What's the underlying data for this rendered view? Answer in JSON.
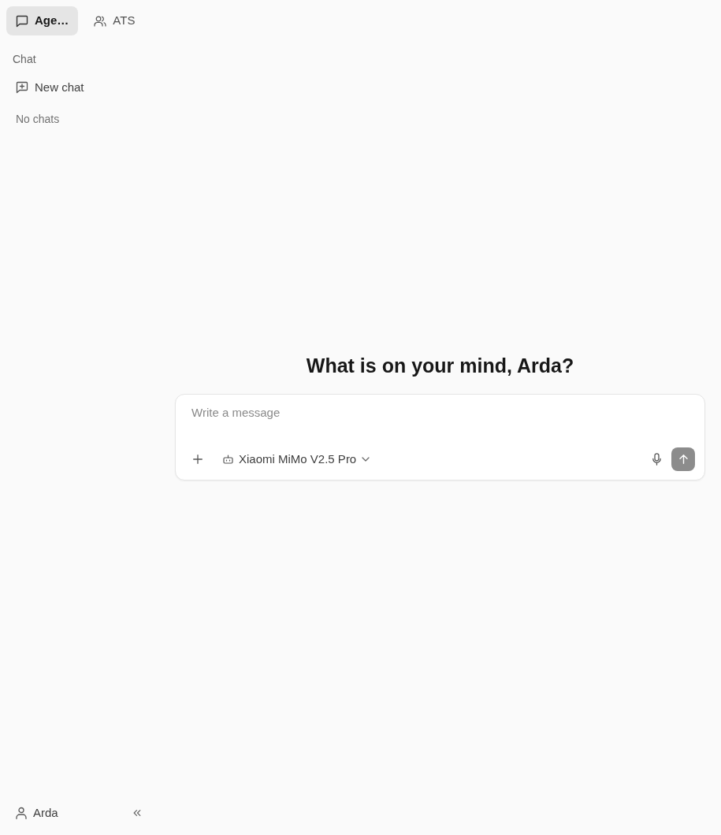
{
  "sidebar": {
    "tabs": [
      {
        "kind": "chat",
        "label": "Age…",
        "selected": true
      },
      {
        "kind": "people",
        "label": "ATS",
        "selected": false
      }
    ],
    "section_title": "Chat",
    "new_chat": "New chat",
    "empty_text": "No chats",
    "user": "Arda"
  },
  "main": {
    "heading": "What is on your mind, Arda?",
    "composer": {
      "placeholder": "Write a message",
      "model": "Xiaomi MiMo V2.5 Pro",
      "send_enabled": false
    }
  }
}
